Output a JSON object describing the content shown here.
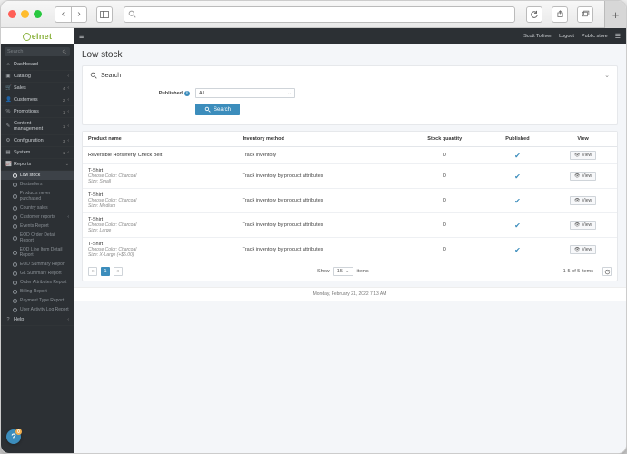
{
  "chrome": {
    "url_placeholder": ""
  },
  "brand": "elnet",
  "topbar": {
    "user": "Scott Tolliver",
    "logout": "Logout",
    "store": "Public store"
  },
  "sidebar": {
    "search_placeholder": "Search",
    "items": [
      {
        "icon": "⌂",
        "label": "Dashboard"
      },
      {
        "icon": "▣",
        "label": "Catalog",
        "caret": true
      },
      {
        "icon": "🛒",
        "label": "Sales",
        "badge": "4",
        "caret": true
      },
      {
        "icon": "👤",
        "label": "Customers",
        "badge": "2",
        "caret": true
      },
      {
        "icon": "%",
        "label": "Promotions",
        "badge": "1",
        "caret": true
      },
      {
        "icon": "✎",
        "label": "Content management",
        "badge": "1",
        "caret": true
      },
      {
        "icon": "⚙",
        "label": "Configuration",
        "badge": "3",
        "caret": true
      },
      {
        "icon": "▦",
        "label": "System",
        "badge": "1",
        "caret": true
      },
      {
        "icon": "📈",
        "label": "Reports",
        "caret": true,
        "expanded": true
      }
    ],
    "reports_children": [
      {
        "label": "Low stock",
        "active": true
      },
      {
        "label": "Bestsellers"
      },
      {
        "label": "Products never purchased"
      },
      {
        "label": "Country sales"
      },
      {
        "label": "Customer reports",
        "caret": true
      },
      {
        "label": "Events Report"
      },
      {
        "label": "EOD Order Detail Report"
      },
      {
        "label": "EOD Line Item Detail Report"
      },
      {
        "label": "EOD Summary Report"
      },
      {
        "label": "GL Summary Report"
      },
      {
        "label": "Order Attributes Report"
      },
      {
        "label": "Billing Report"
      },
      {
        "label": "Payment Type Report"
      },
      {
        "label": "User Activity Log Report"
      }
    ],
    "help": {
      "icon": "?",
      "label": "Help",
      "caret": true
    }
  },
  "page": {
    "title": "Low stock"
  },
  "search": {
    "header_icon": "search",
    "header_label": "Search",
    "field_label": "Published",
    "select_value": "All",
    "button": "Search"
  },
  "table": {
    "columns": [
      "Product name",
      "Inventory method",
      "Stock quantity",
      "Published",
      "View"
    ],
    "rows": [
      {
        "name": "Reversible Horseferry Check Belt",
        "variant": "",
        "method": "Track inventory",
        "qty": "0",
        "published": true
      },
      {
        "name": "T-Shirt",
        "variant": "Choose Color: Charcoal<br />Size: Small",
        "method": "Track inventory by product attributes",
        "qty": "0",
        "published": true
      },
      {
        "name": "T-Shirt",
        "variant": "Choose Color: Charcoal<br />Size: Medium",
        "method": "Track inventory by product attributes",
        "qty": "0",
        "published": true
      },
      {
        "name": "T-Shirt",
        "variant": "Choose Color: Charcoal<br />Size: Large",
        "method": "Track inventory by product attributes",
        "qty": "0",
        "published": true
      },
      {
        "name": "T-Shirt",
        "variant": "Choose Color: Charcoal<br />Size: X-Large (+$5.00)",
        "method": "Track inventory by product attributes",
        "qty": "0",
        "published": true
      }
    ],
    "view_label": "View",
    "footer": {
      "show_label": "Show",
      "page_size": "15",
      "items_label": "items",
      "range": "1-5 of 5 items"
    }
  },
  "footer_date": "Monday, February 21, 2022 7:13 AM",
  "help_bubble": {
    "count": "0"
  }
}
